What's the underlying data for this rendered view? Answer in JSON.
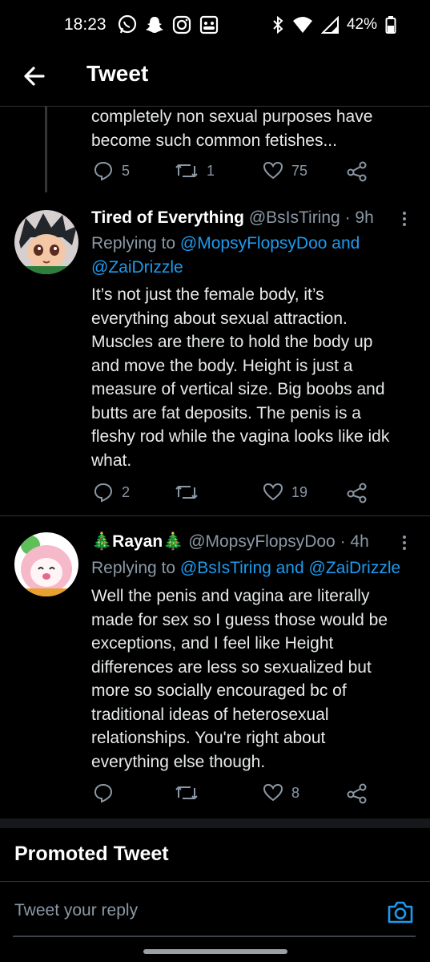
{
  "status_bar": {
    "time": "18:23",
    "battery": "42%"
  },
  "header": {
    "title": "Tweet"
  },
  "tweets": [
    {
      "text_lines": [
        "completely non sexual purposes have",
        "become such common fetishes..."
      ],
      "actions": {
        "replies": "5",
        "retweets": "1",
        "likes": "75"
      }
    },
    {
      "author_name": "Tired of Everything",
      "handle": "@BsIsTiring",
      "time": "· 9h",
      "replying_prefix": "Replying to",
      "replying_to_1": "@MopsyFlopsyDoo and",
      "replying_to_2": "@ZaiDrizzle",
      "text_lines": [
        "It’s not just the female body, it’s",
        "everything about sexual attraction.",
        "Muscles are there to hold the body up",
        "and move the body. Height is just a",
        "measure of vertical size. Big boobs and",
        "butts are fat deposits. The penis is a",
        "fleshy rod while the vagina looks like idk",
        "what."
      ],
      "actions": {
        "replies": "2",
        "retweets": "",
        "likes": "19"
      }
    },
    {
      "author_emoji": "🎄",
      "author_name": "Rayan",
      "handle": "@MopsyFlopsyDoo",
      "time": "· 4h",
      "replying_prefix": "Replying to",
      "replying_to": "@BsIsTiring and @ZaiDrizzle",
      "text_lines": [
        "Well the penis and vagina are literally",
        "made for sex so I guess those would be",
        "exceptions, and I feel like Height",
        "differences are less so sexualized but",
        "more so socially encouraged bc of",
        "traditional ideas of heterosexual",
        "relationships. You're right about",
        "everything else though."
      ],
      "actions": {
        "replies": "",
        "retweets": "",
        "likes": "8"
      }
    }
  ],
  "promoted": {
    "label": "Promoted Tweet"
  },
  "reply": {
    "placeholder": "Tweet your reply"
  },
  "colors": {
    "background": "#000000",
    "text": "#e7e9ea",
    "secondary": "#8b98a5",
    "link": "#1d9bf0"
  }
}
